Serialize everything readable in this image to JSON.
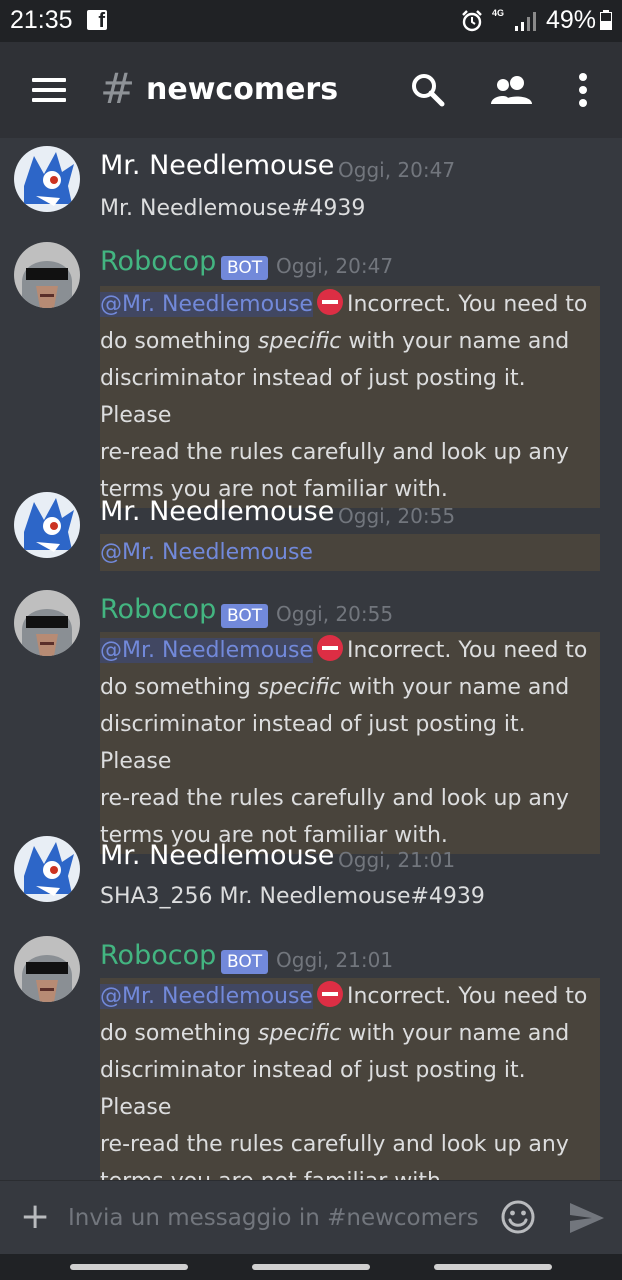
{
  "status_bar": {
    "time": "21:35",
    "fb_icon": "f",
    "network": "4G",
    "battery_percent": "49%"
  },
  "header": {
    "hash": "#",
    "channel": "newcomers",
    "icons": [
      "menu-icon",
      "search-icon",
      "members-icon",
      "more-vert-icon"
    ]
  },
  "messages": [
    {
      "author": "Mr. Needlemouse",
      "is_bot": false,
      "timestamp": "Oggi, 20:47",
      "text": "Mr. Needlemouse#4939"
    },
    {
      "author": "Robocop",
      "is_bot": true,
      "badge": "BOT",
      "timestamp": "Oggi, 20:47",
      "mention": "@Mr. Needlemouse",
      "lines": [
        "Incorrect. You need to",
        "do something ",
        "specific",
        " with your name and",
        "discriminator instead of just posting it. Please",
        "re-read the rules carefully and look up any",
        "terms you are not familiar with."
      ]
    },
    {
      "author": "Mr. Needlemouse",
      "is_bot": false,
      "timestamp": "Oggi, 20:55",
      "mention": "@Mr. Needlemouse"
    },
    {
      "author": "Robocop",
      "is_bot": true,
      "badge": "BOT",
      "timestamp": "Oggi, 20:55",
      "mention": "@Mr. Needlemouse",
      "lines": [
        "Incorrect. You need to",
        "do something ",
        "specific",
        " with your name and",
        "discriminator instead of just posting it. Please",
        "re-read the rules carefully and look up any",
        "terms you are not familiar with."
      ]
    },
    {
      "author": "Mr. Needlemouse",
      "is_bot": false,
      "timestamp": "Oggi, 21:01",
      "text": "SHA3_256 Mr. Needlemouse#4939"
    },
    {
      "author": "Robocop",
      "is_bot": true,
      "badge": "BOT",
      "timestamp": "Oggi, 21:01",
      "mention": "@Mr. Needlemouse",
      "lines": [
        "Incorrect. You need to",
        "do something ",
        "specific",
        " with your name and",
        "discriminator instead of just posting it. Please",
        "re-read the rules carefully and look up any",
        "terms you are not familiar with."
      ]
    }
  ],
  "composer": {
    "plus": "+",
    "placeholder": "Invia un messaggio in #newcomers"
  },
  "colors": {
    "background": "#36393f",
    "header": "#2f3136",
    "bot_name": "#43b581",
    "bot_badge": "#7289da",
    "mention": "#7289da",
    "highlight": "#49443c"
  }
}
